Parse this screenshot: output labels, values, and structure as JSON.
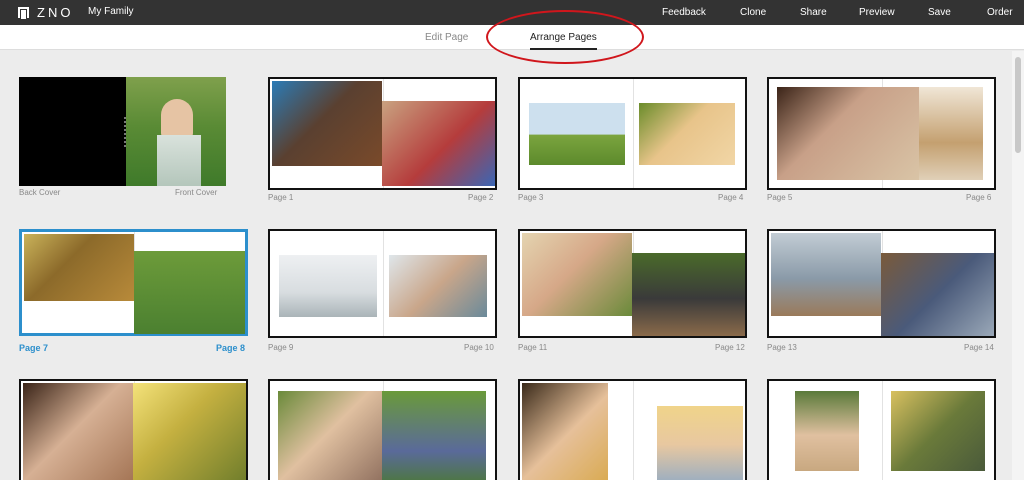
{
  "header": {
    "logo": "ZNO",
    "project_title": "My Family",
    "actions": [
      "Feedback",
      "Clone",
      "Share",
      "Preview",
      "Save",
      "Order"
    ]
  },
  "tabs": {
    "edit_page": "Edit Page",
    "arrange_pages": "Arrange Pages",
    "active": "Arrange Pages"
  },
  "spreads": [
    {
      "left_label": "Back Cover",
      "right_label": "Front Cover"
    },
    {
      "left_label": "Page 1",
      "right_label": "Page 2"
    },
    {
      "left_label": "Page 3",
      "right_label": "Page 4"
    },
    {
      "left_label": "Page 5",
      "right_label": "Page 6"
    },
    {
      "left_label": "Page 7",
      "right_label": "Page 8",
      "selected": true
    },
    {
      "left_label": "Page 9",
      "right_label": "Page 10"
    },
    {
      "left_label": "Page 11",
      "right_label": "Page 12"
    },
    {
      "left_label": "Page 13",
      "right_label": "Page 14"
    },
    {},
    {},
    {},
    {}
  ],
  "colors": {
    "topbar": "#333333",
    "selection": "#2c8fcc",
    "annotation": "#d0161c"
  }
}
